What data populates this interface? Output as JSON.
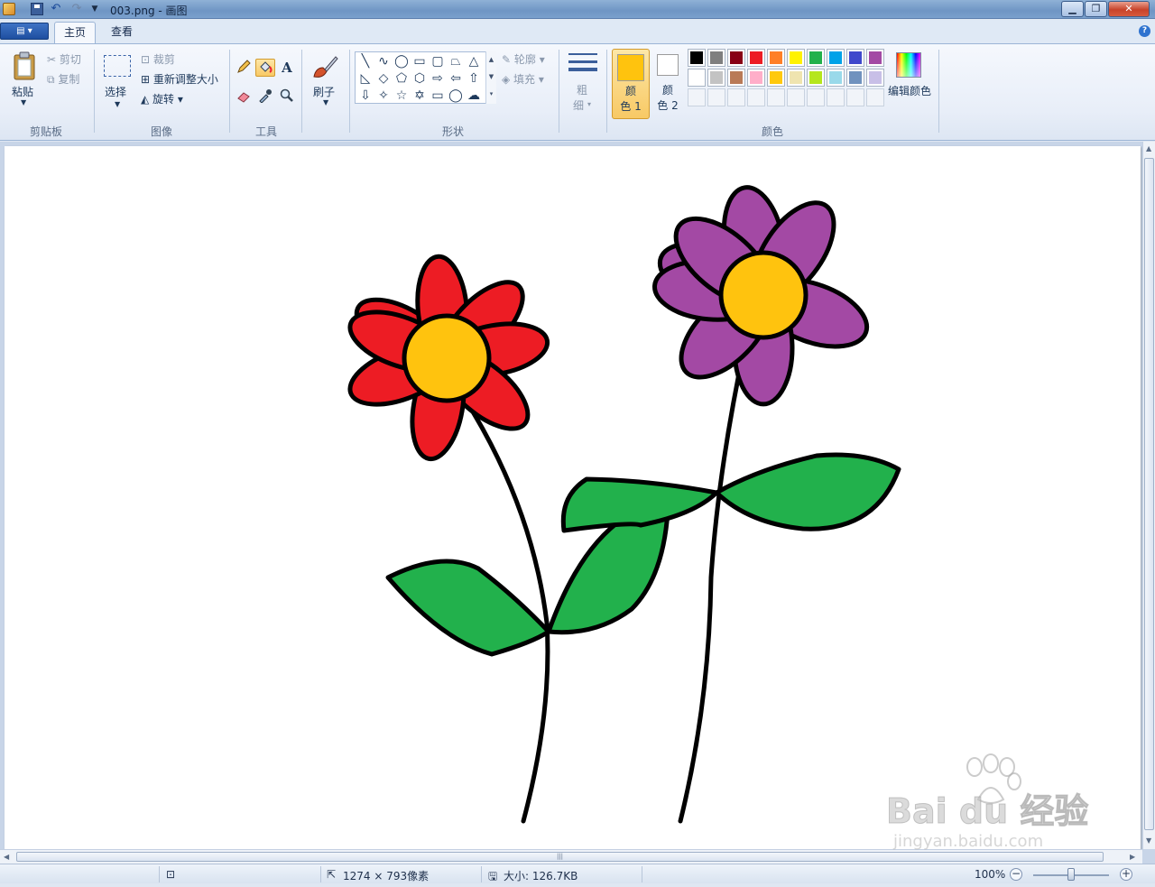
{
  "window": {
    "title": "003.png - 画图"
  },
  "tabs": [
    {
      "label": "主页"
    },
    {
      "label": "查看"
    }
  ],
  "clipboard": {
    "paste": "粘贴",
    "cut": "剪切",
    "copy": "复制",
    "group": "剪贴板"
  },
  "image": {
    "select": "选择",
    "crop": "裁剪",
    "resize": "重新调整大小",
    "rotate": "旋转",
    "group": "图像"
  },
  "tools": {
    "group": "工具",
    "text_tool": "A"
  },
  "brushes": {
    "label": "刷子"
  },
  "shapes": {
    "outline": "轮廓",
    "fill": "填充",
    "group": "形状"
  },
  "size": {
    "label_1": "粗",
    "label_2": "细"
  },
  "colors": {
    "color1_a": "颜",
    "color1_b": "色 1",
    "color2_a": "颜",
    "color2_b": "色 2",
    "edit": "编辑颜色",
    "group": "颜色",
    "color1_value": "#ffc30e",
    "color2_value": "#ffffff",
    "palette_row1": [
      "#000000",
      "#7f7f7f",
      "#880015",
      "#ed1c24",
      "#ff7f27",
      "#fff200",
      "#22b14c",
      "#00a2e8",
      "#3f48cc",
      "#a349a4"
    ],
    "palette_row2": [
      "#ffffff",
      "#c3c3c3",
      "#b97a57",
      "#ffaec9",
      "#ffc90e",
      "#efe4b0",
      "#b5e61d",
      "#99d9ea",
      "#7092be",
      "#c8bfe7"
    ]
  },
  "drawing": {
    "left_flower": {
      "petal": "#ed1c24",
      "center": "#ffc30e"
    },
    "right_flower": {
      "petal": "#a349a4",
      "center": "#ffc30e"
    },
    "leaf": "#22b14c",
    "outline": "#000000"
  },
  "status": {
    "dimensions": "1274 × 793像素",
    "filesize": "大小: 126.7KB",
    "zoom": "100%"
  },
  "watermark": {
    "brand": "Bai du 经验",
    "url": "jingyan.baidu.com"
  }
}
